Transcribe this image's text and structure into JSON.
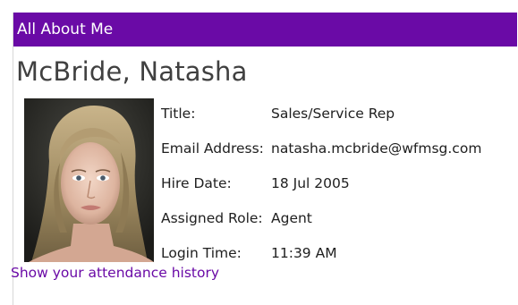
{
  "panel": {
    "title": "All About Me",
    "header_color": "#6a0aa6"
  },
  "profile": {
    "name": "McBride, Natasha",
    "photo_icon": "user-photo",
    "fields": [
      {
        "label": "Title:",
        "value": "Sales/Service Rep"
      },
      {
        "label": "Email Address:",
        "value": "natasha.mcbride@wfmsg.com"
      },
      {
        "label": "Hire Date:",
        "value": "18 Jul 2005"
      },
      {
        "label": "Assigned Role:",
        "value": "Agent"
      },
      {
        "label": "Login Time:",
        "value": "11:39 AM"
      }
    ]
  },
  "links": {
    "attendance": "Show your attendance history"
  }
}
